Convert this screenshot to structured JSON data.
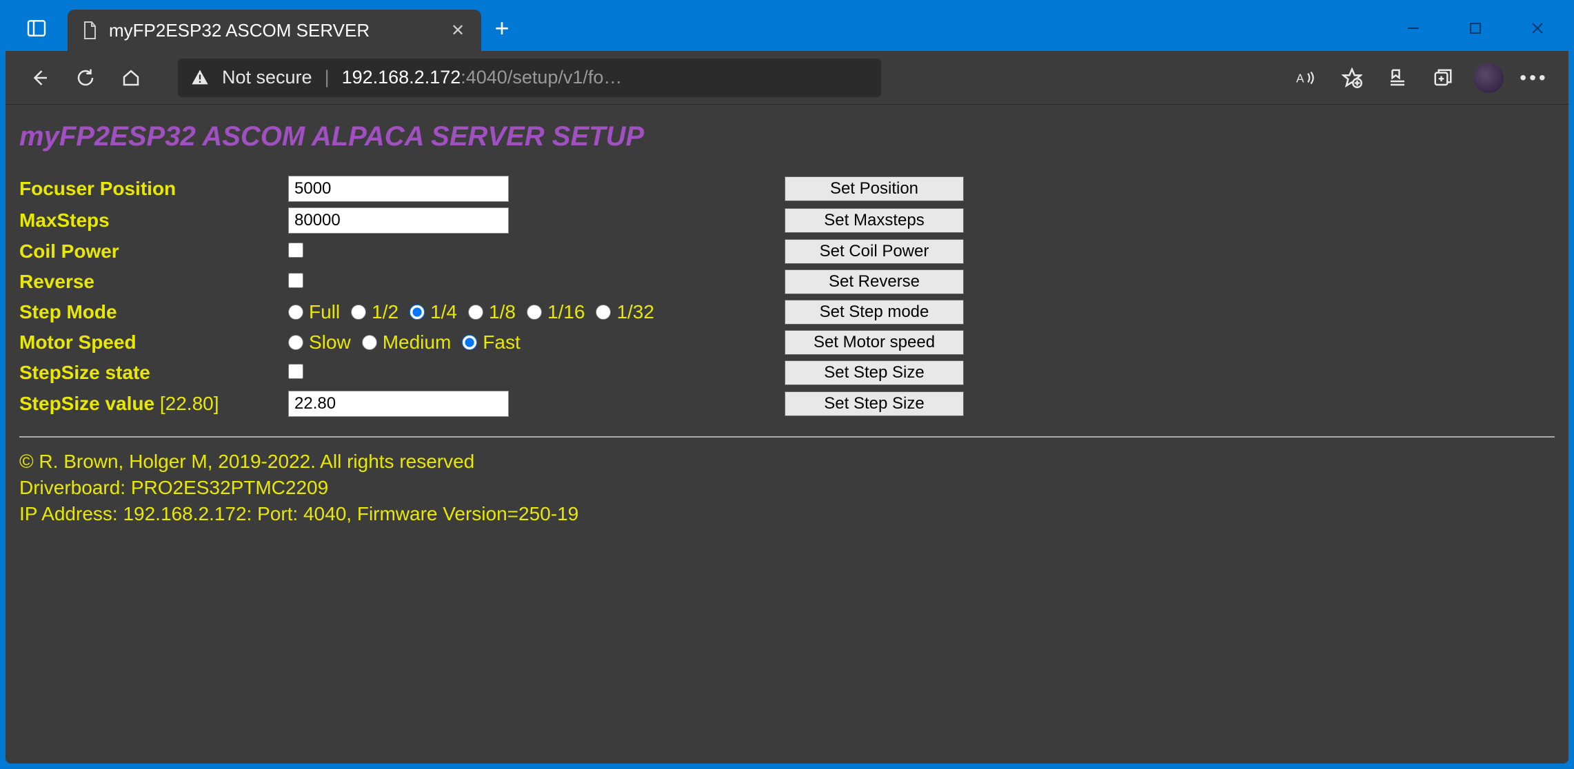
{
  "window": {
    "tab_title": "myFP2ESP32 ASCOM SERVER"
  },
  "addressbar": {
    "security_label": "Not secure",
    "url_host": "192.168.2.172",
    "url_path": ":4040/setup/v1/fo…"
  },
  "page": {
    "title": "myFP2ESP32 ASCOM ALPACA SERVER SETUP"
  },
  "form": {
    "focuser_position": {
      "label": "Focuser Position",
      "value": "5000",
      "button": "Set Position"
    },
    "max_steps": {
      "label": "MaxSteps",
      "value": "80000",
      "button": "Set Maxsteps"
    },
    "coil_power": {
      "label": "Coil Power",
      "button": "Set Coil Power"
    },
    "reverse": {
      "label": "Reverse",
      "button": "Set Reverse"
    },
    "step_mode": {
      "label": "Step Mode",
      "button": "Set Step mode",
      "options": {
        "full": "Full",
        "half": "1/2",
        "quarter": "1/4",
        "eighth": "1/8",
        "sixteenth": "1/16",
        "thirtysecond": "1/32"
      },
      "selected": "quarter"
    },
    "motor_speed": {
      "label": "Motor Speed",
      "button": "Set Motor speed",
      "options": {
        "slow": "Slow",
        "medium": "Medium",
        "fast": "Fast"
      },
      "selected": "fast"
    },
    "stepsize_state": {
      "label": "StepSize state",
      "button": "Set Step Size"
    },
    "stepsize_value": {
      "label": "StepSize value",
      "bracket": "[22.80]",
      "value": "22.80",
      "button": "Set Step Size"
    }
  },
  "footer": {
    "copyright": "© R. Brown, Holger M, 2019-2022. All rights reserved",
    "driverboard": "Driverboard: PRO2ES32PTMC2209",
    "ipline": "IP Address: 192.168.2.172: Port: 4040, Firmware Version=250-19"
  }
}
